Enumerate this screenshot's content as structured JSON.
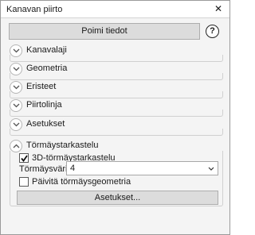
{
  "window": {
    "title": "Kanavan piirto"
  },
  "toolbar": {
    "fetch_label": "Poimi tiedot"
  },
  "help": {
    "glyph": "?"
  },
  "sections": [
    {
      "label": "Kanavalaji",
      "expanded": false
    },
    {
      "label": "Geometria",
      "expanded": false
    },
    {
      "label": "Eristeet",
      "expanded": false
    },
    {
      "label": "Piirtolinja",
      "expanded": false
    },
    {
      "label": "Asetukset",
      "expanded": false
    },
    {
      "label": "Törmäystarkastelu",
      "expanded": true
    }
  ],
  "collision": {
    "enable_3d": {
      "label": "3D-törmäystarkastelu",
      "checked": true
    },
    "color": {
      "label": "Törmäysväri:",
      "value": "4"
    },
    "update_geometry": {
      "label": "Päivitä törmäysgeometria",
      "checked": false
    },
    "settings_label": "Asetukset..."
  }
}
